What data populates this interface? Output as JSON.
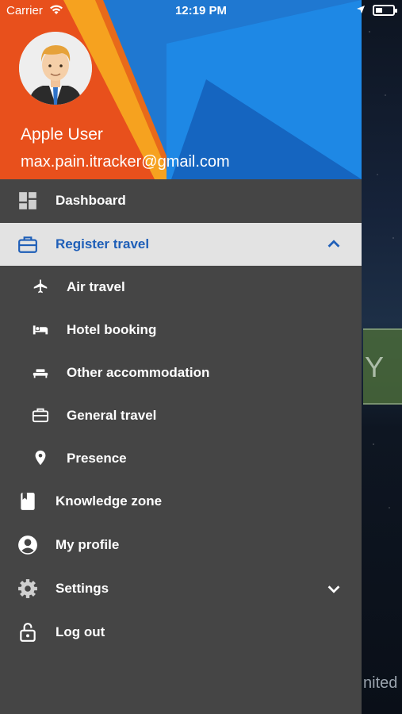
{
  "status_bar": {
    "carrier": "Carrier",
    "time": "12:19 PM"
  },
  "user": {
    "name": "Apple User",
    "email": "max.pain.itracker@gmail.com"
  },
  "menu": {
    "dashboard": "Dashboard",
    "register_travel": "Register travel",
    "air_travel": "Air travel",
    "hotel_booking": "Hotel booking",
    "other_accommodation": "Other accommodation",
    "general_travel": "General travel",
    "presence": "Presence",
    "knowledge_zone": "Knowledge zone",
    "my_profile": "My profile",
    "settings": "Settings",
    "log_out": "Log out"
  },
  "background": {
    "card_text": "Y",
    "footer_text": "nited"
  },
  "colors": {
    "drawer_bg": "#454545",
    "active_bg": "#e3e3e3",
    "active_text": "#1f5fb8",
    "header_orange": "#e8501c",
    "header_blue": "#1e88e5"
  }
}
